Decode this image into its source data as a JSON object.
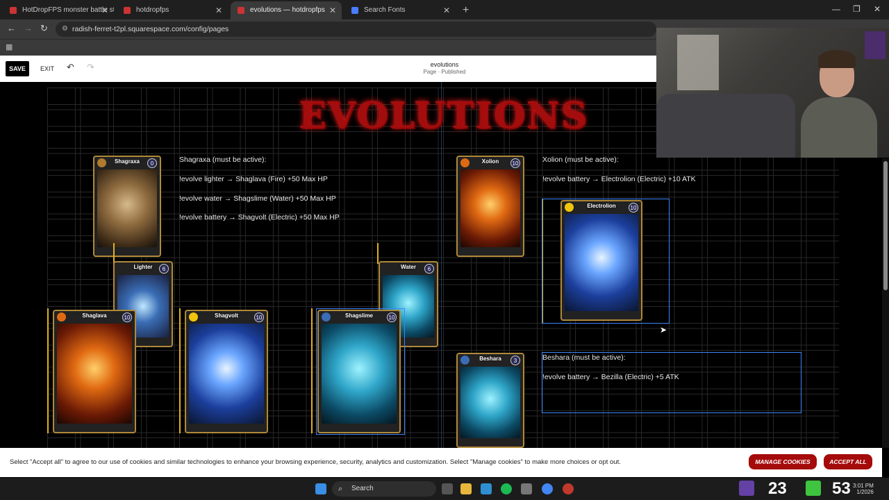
{
  "browser": {
    "tabs": [
      {
        "label": "HotDropFPS monster battle sty",
        "color": "#e33"
      },
      {
        "label": "hotdropfps",
        "color": "#e33"
      },
      {
        "label": "evolutions — hotdropfps",
        "color": "#e33"
      },
      {
        "label": "Search Fonts",
        "color": "#4a7cff"
      }
    ],
    "url": "radish-ferret-t2pl.squarespace.com/config/pages"
  },
  "editor": {
    "save_label": "SAVE",
    "exit_label": "EXIT",
    "page_title": "evolutions",
    "page_status": "Page · Published"
  },
  "canvas": {
    "banner_title": "EVOLUTIONS",
    "shagraxa": {
      "heading": "Shagraxa (must be active):",
      "lines": [
        "!evolve lighter → Shaglava (Fire) +50 Max HP",
        "!evolve water → Shagslime (Water) +50 Max HP",
        "!evolve battery → Shagvolt (Electric) +50 Max HP"
      ]
    },
    "xolion": {
      "heading": "Xolion (must be active):",
      "lines": [
        "!evolve battery → Electrolion (Electric) +10 ATK"
      ]
    },
    "beshara": {
      "heading": "Beshara (must be active):",
      "lines": [
        "!evolve battery → Bezilla (Electric) +5 ATK"
      ]
    },
    "cards": {
      "shagraxa": {
        "name": "Shagraxa",
        "level": "0"
      },
      "lighter": {
        "name": "Lighter",
        "level": "6"
      },
      "shaglava": {
        "name": "Shaglava",
        "level": "10"
      },
      "shagvolt": {
        "name": "Shagvolt",
        "level": "10"
      },
      "shagslime": {
        "name": "Shagslime",
        "level": "10"
      },
      "water": {
        "name": "Water",
        "level": "6"
      },
      "xolion": {
        "name": "Xolion",
        "level": "10"
      },
      "electrolion": {
        "name": "Electrolion",
        "level": "10"
      },
      "beshara": {
        "name": "Beshara",
        "level": "3"
      }
    }
  },
  "cookie": {
    "message": "Select \"Accept all\" to agree to our use of cookies and similar technologies to enhance your browsing experience, security, analytics and customization. Select \"Manage cookies\" to make more choices or opt out.",
    "manage_label": "MANAGE COOKIES",
    "accept_label": "ACCEPT ALL"
  },
  "taskbar": {
    "search_label": "Search",
    "count_a": "23",
    "count_b": "53",
    "time": "3:01 PM",
    "date": "1/2026"
  }
}
